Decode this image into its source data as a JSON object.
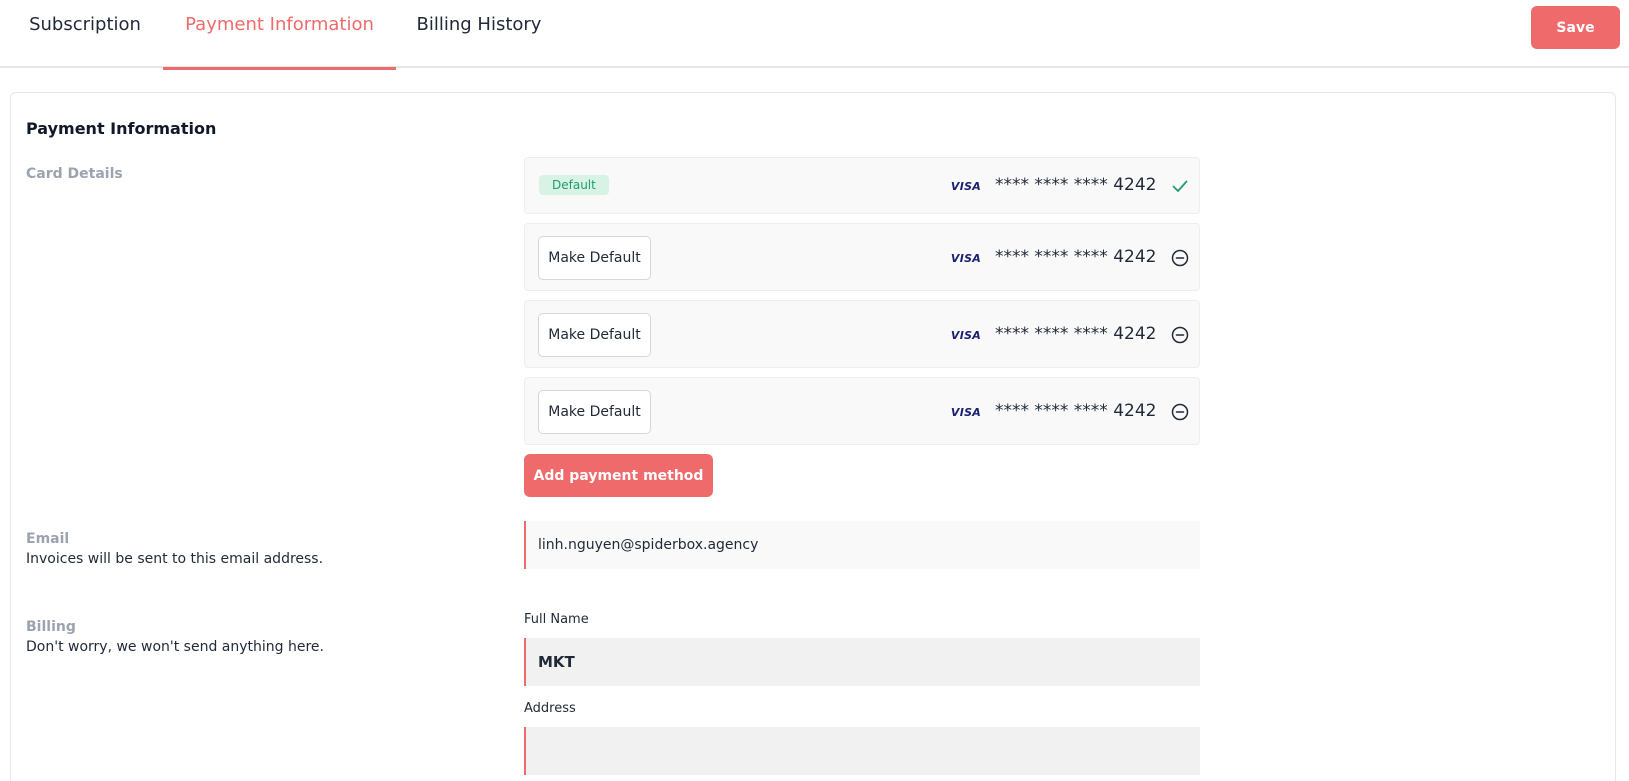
{
  "tabs": [
    {
      "label": "Subscription"
    },
    {
      "label": "Payment Information"
    },
    {
      "label": "Billing History"
    }
  ],
  "toolbar": {
    "save_label": "Save"
  },
  "section": {
    "title": "Payment Information"
  },
  "card_details": {
    "label": "Card Details",
    "default_badge": "Default",
    "make_default_label": "Make Default",
    "brand": "VISA",
    "cards": [
      {
        "number": "**** **** **** 4242",
        "is_default": true
      },
      {
        "number": "**** **** **** 4242",
        "is_default": false
      },
      {
        "number": "**** **** **** 4242",
        "is_default": false
      },
      {
        "number": "**** **** **** 4242",
        "is_default": false
      }
    ],
    "add_label": "Add payment method"
  },
  "email": {
    "label": "Email",
    "description": "Invoices will be sent to this email address.",
    "value": "linh.nguyen@spiderbox.agency"
  },
  "billing": {
    "label": "Billing",
    "description": "Don't worry, we won't send anything here.",
    "full_name_label": "Full Name",
    "full_name_value": "MKT",
    "address_label": "Address",
    "address_value": ""
  },
  "colors": {
    "accent": "#ef6a6a",
    "success": "#1f9d6b",
    "visa": "#1a1f71"
  }
}
